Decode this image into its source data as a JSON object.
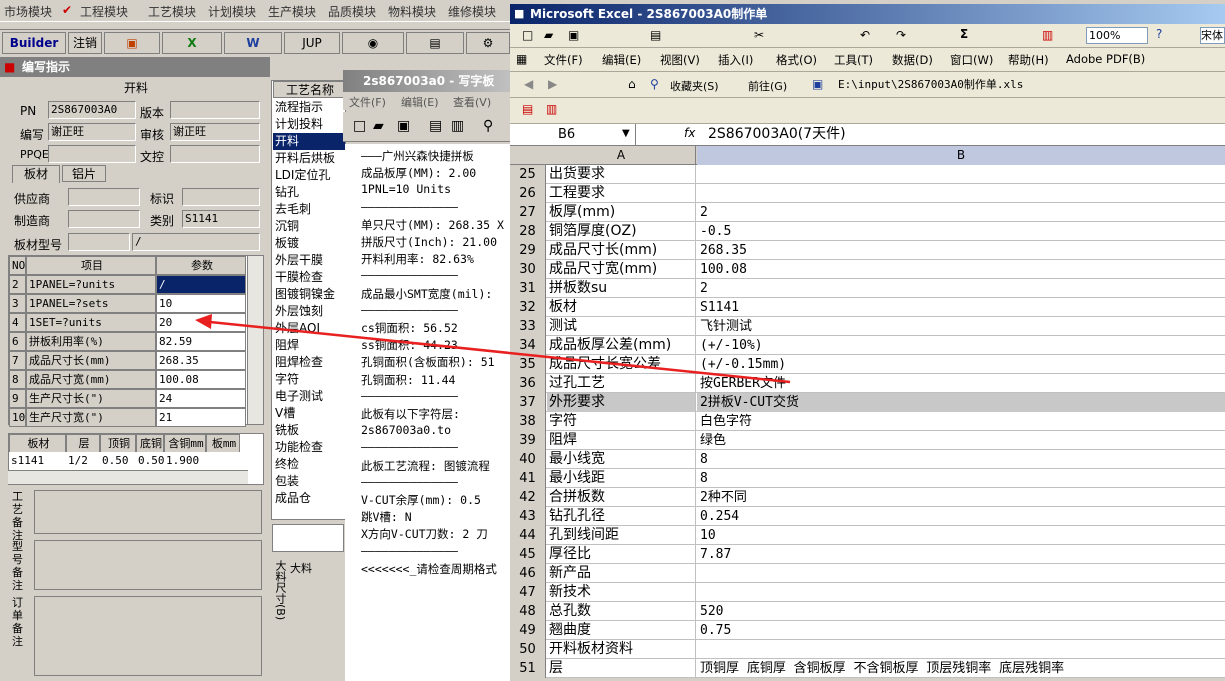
{
  "left_app": {
    "menu": [
      "市场模块",
      "工程模块",
      "工艺模块",
      "计划模块",
      "生产模块",
      "品质模块",
      "物料模块",
      "维修模块"
    ],
    "toolbar": {
      "builder": "Builder",
      "logout": "注销",
      "jup": "JUP"
    },
    "panel_title": "编写指示",
    "section_cut": "开料",
    "pn_label": "PN",
    "pn_value": "2S867003A0",
    "version_label": "版本",
    "version_value": "",
    "author_label": "编写",
    "author_value": "谢正旺",
    "review_label": "审核",
    "review_value": "谢正旺",
    "ppqe_label": "PPQE",
    "ppqe_value": "",
    "doc_label": "文控",
    "doc_value": "",
    "tabs": [
      "板材",
      "铝片"
    ],
    "supplier_label": "供应商",
    "supplier_value": "",
    "mark_label": "标识",
    "mark_value": "",
    "maker_label": "制造商",
    "maker_value": "",
    "type_label": "类别",
    "type_value": "S1141",
    "model_label": "板材型号",
    "model_value": "",
    "model_value2": "/",
    "grid_headers": [
      "NO",
      "项目",
      "参数"
    ],
    "grid_rows": [
      {
        "no": "2",
        "item": "1PANEL=?units",
        "val": "/"
      },
      {
        "no": "3",
        "item": "1PANEL=?sets",
        "val": "10"
      },
      {
        "no": "4",
        "item": "1SET=?units",
        "val": "20"
      },
      {
        "no": "6",
        "item": "拼板利用率(%)",
        "val": "82.59"
      },
      {
        "no": "7",
        "item": "成品尺寸长(mm)",
        "val": "268.35"
      },
      {
        "no": "8",
        "item": "成品尺寸宽(mm)",
        "val": "100.08"
      },
      {
        "no": "9",
        "item": "生产尺寸长(\")",
        "val": "24"
      },
      {
        "no": "10",
        "item": "生产尺寸宽(\")",
        "val": "21"
      }
    ],
    "mat_headers": [
      "板材",
      "层",
      "顶铜",
      "底铜",
      "含铜mm",
      "板mm"
    ],
    "mat_row": [
      "s1141",
      "1/2",
      "0.50",
      "0.50",
      "1.900",
      ""
    ],
    "remark_labels": [
      "工艺备注",
      "型号备注",
      "订单备注"
    ],
    "proc_title": "工艺名称",
    "processes": [
      "流程指示",
      "计划投料",
      "开料",
      "开料后烘板",
      "LDI定位孔",
      "钻孔",
      "去毛刺",
      "沉铜",
      "板镀",
      "外层干膜",
      "干膜检查",
      "图镀铜镍金",
      "外层蚀刻",
      "外层AOI",
      "阻焊",
      "阻焊检查",
      "字符",
      "电子测试",
      "V槽",
      "铣板",
      "功能检查",
      "终检",
      "包装",
      "成品仓"
    ],
    "size_label": "大料尺寸(B)",
    "size_label2": "大料"
  },
  "notepad": {
    "title": "2s867003a0 - 写字板",
    "menu": [
      "文件(F)",
      "编辑(E)",
      "查看(V)"
    ],
    "lines": [
      "———广州兴森快捷拼板",
      "成品板厚(MM): 2.00",
      "1PNL=10 Units",
      "——————————————",
      "单只尺寸(MM): 268.35 X",
      "拼版尺寸(Inch): 21.00",
      "开料利用率: 82.63%",
      "——————————————",
      "成品最小SMT宽度(mil):",
      "——————————————",
      "cs铜面积: 56.52",
      "ss铜面积: 44.23",
      "孔铜面积(含板面积): 51",
      "孔铜面积: 11.44",
      "——————————————",
      "此板有以下字符层:",
      "2s867003a0.to",
      "——————————————",
      "此板工艺流程: 图镀流程",
      "——————————————",
      "V-CUT余厚(mm): 0.5",
      "跳V槽: N",
      "X方向V-CUT刀数: 2 刀",
      "——————————————",
      "<<<<<<<_请检查周期格式"
    ]
  },
  "excel": {
    "title": "Microsoft Excel - 2S867003A0制作单",
    "menu": [
      "文件(F)",
      "编辑(E)",
      "视图(V)",
      "插入(I)",
      "格式(O)",
      "工具(T)",
      "数据(D)",
      "窗口(W)",
      "帮助(H)",
      "Adobe PDF(B)"
    ],
    "font_name": "宋体",
    "zoom": "100%",
    "favorites": "收藏夹(S)",
    "forward": "前往(G)",
    "path": "E:\\input\\2S867003A0制作单.xls",
    "cell_ref": "B6",
    "formula": "2S867003A0(7天件)",
    "col_a": "A",
    "col_b": "B",
    "rows": [
      {
        "n": "25",
        "a": "出货要求",
        "b": ""
      },
      {
        "n": "26",
        "a": "工程要求",
        "b": ""
      },
      {
        "n": "27",
        "a": "板厚(mm)",
        "b": "2"
      },
      {
        "n": "28",
        "a": "铜箔厚度(OZ)",
        "b": "-0.5"
      },
      {
        "n": "29",
        "a": "成品尺寸长(mm)",
        "b": "268.35"
      },
      {
        "n": "30",
        "a": "成品尺寸宽(mm)",
        "b": "100.08"
      },
      {
        "n": "31",
        "a": "拼板数su",
        "b": "2"
      },
      {
        "n": "32",
        "a": "板材",
        "b": "S1141"
      },
      {
        "n": "33",
        "a": "测试",
        "b": "飞针测试"
      },
      {
        "n": "34",
        "a": "成品板厚公差(mm)",
        "b": "(+/-10%)"
      },
      {
        "n": "35",
        "a": "成品尺寸长宽公差",
        "b": "(+/-0.15mm)"
      },
      {
        "n": "36",
        "a": "过孔工艺",
        "b": "按GERBER文件"
      },
      {
        "n": "37",
        "a": "外形要求",
        "b": "2拼板V-CUT交货"
      },
      {
        "n": "38",
        "a": "字符",
        "b": "白色字符"
      },
      {
        "n": "39",
        "a": "阻焊",
        "b": "绿色"
      },
      {
        "n": "40",
        "a": "最小线宽",
        "b": "8"
      },
      {
        "n": "41",
        "a": "最小线距",
        "b": "8"
      },
      {
        "n": "42",
        "a": "合拼板数",
        "b": "2种不同"
      },
      {
        "n": "43",
        "a": "钻孔孔径",
        "b": "0.254"
      },
      {
        "n": "44",
        "a": "孔到线间距",
        "b": "10"
      },
      {
        "n": "45",
        "a": "厚径比",
        "b": "7.87"
      },
      {
        "n": "46",
        "a": "新产品",
        "b": ""
      },
      {
        "n": "47",
        "a": "新技术",
        "b": ""
      },
      {
        "n": "48",
        "a": "总孔数",
        "b": "520"
      },
      {
        "n": "49",
        "a": "翘曲度",
        "b": "0.75"
      },
      {
        "n": "50",
        "a": "开料板材资料",
        "b": ""
      },
      {
        "n": "51",
        "a": "层",
        "b": "顶铜厚  底铜厚  含铜板厚  不含铜板厚  顶层残铜率  底层残铜率"
      }
    ]
  }
}
